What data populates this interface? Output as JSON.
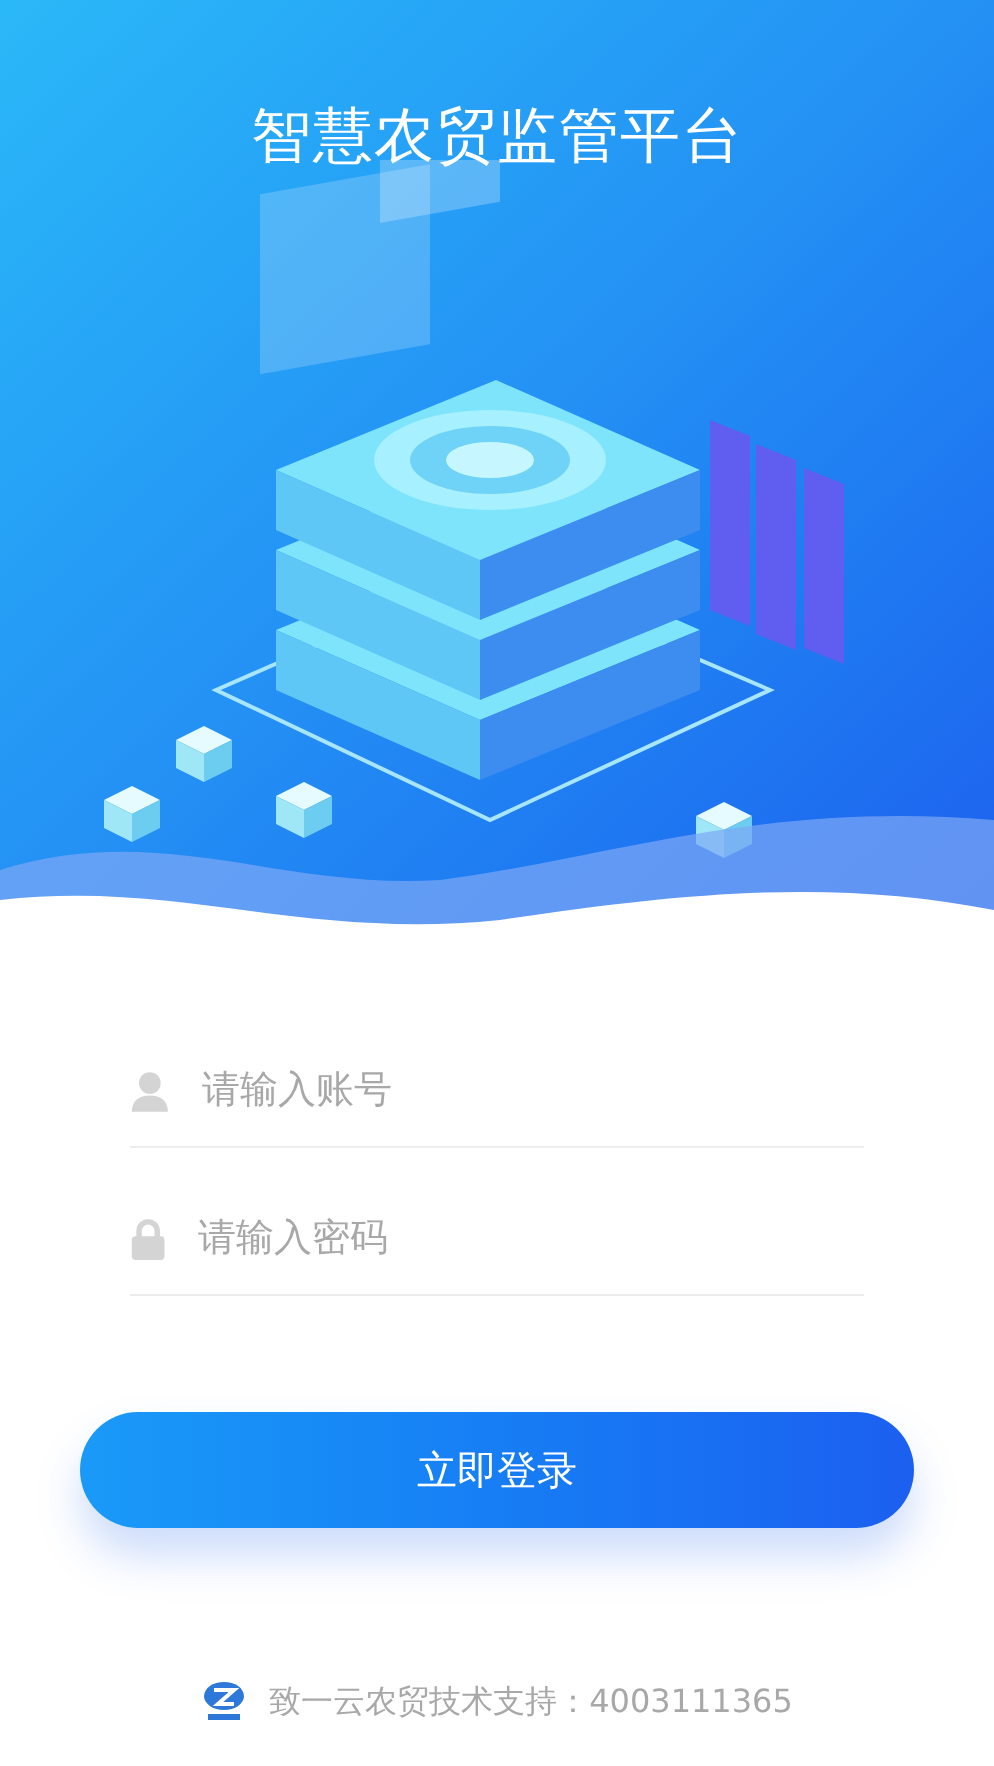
{
  "header": {
    "title": "智慧农贸监管平台"
  },
  "fields": [
    {
      "kind": "user",
      "placeholder": "请输入账号"
    },
    {
      "kind": "lock",
      "placeholder": "请输入密码"
    }
  ],
  "login_button": "立即登录",
  "footer": {
    "text": "致一云农贸技术支持：4003111365"
  }
}
